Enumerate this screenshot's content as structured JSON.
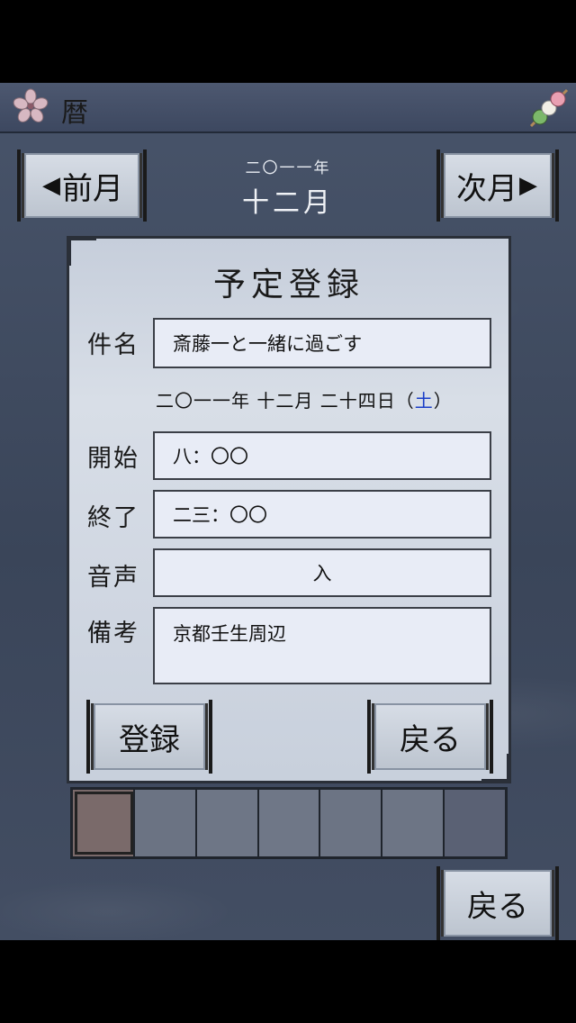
{
  "header": {
    "title": "暦",
    "logo_icon": "sakura-icon",
    "menu_icon": "dango-icon"
  },
  "month_nav": {
    "prev_label": "前月",
    "next_label": "次月",
    "year": "二〇一一年",
    "month": "十二月"
  },
  "dialog": {
    "title": "予定登録",
    "fields": {
      "subject_label": "件名",
      "subject_value": "斎藤一と一緒に過ごす",
      "date_text": "二〇一一年 十二月 二十四日（",
      "date_weekday": "土",
      "date_close": "）",
      "start_label": "開始",
      "start_value": "八：〇〇",
      "end_label": "終了",
      "end_value": "二三：〇〇",
      "sound_label": "音声",
      "sound_value": "入",
      "notes_label": "備考",
      "notes_value": "京都壬生周辺"
    },
    "register_label": "登録",
    "back_label": "戻る"
  },
  "colors": {
    "swatches": [
      "#7a6a6a",
      "#6b7383",
      "#6e7686",
      "#6f7787",
      "#6c7484",
      "#6d7585",
      "#5a6174"
    ],
    "selected_index": 0
  },
  "footer": {
    "back_label": "戻る"
  },
  "theme": {
    "accent_blue": "#1a3ec8",
    "frame": "#2a2f38"
  }
}
